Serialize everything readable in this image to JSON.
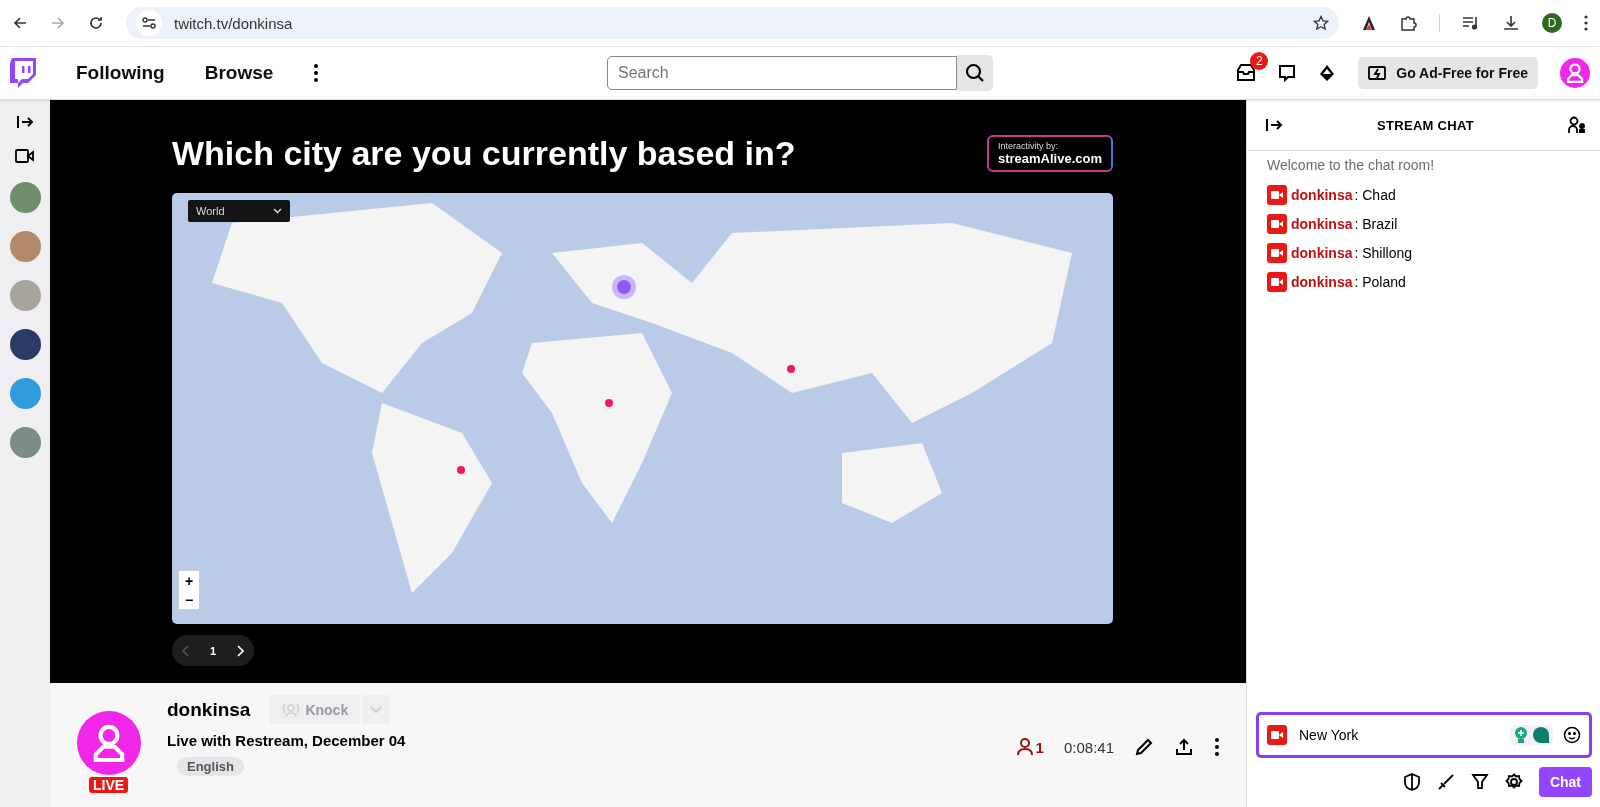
{
  "browser": {
    "url": "twitch.tv/donkinsa",
    "profile_initial": "D"
  },
  "nav": {
    "links": [
      "Following",
      "Browse"
    ],
    "search": {
      "placeholder": "Search"
    },
    "inbox_count": "2",
    "ad_free": "Go Ad-Free for Free"
  },
  "player": {
    "question": "Which city are you currently based in?",
    "badge_caption": "Interactivity by:",
    "badge_brand": "streamAlive.com",
    "map_region": "World",
    "zoom_in": "+",
    "zoom_out": "−",
    "page": "1"
  },
  "stream": {
    "channel": "donkinsa",
    "live_badge": "LIVE",
    "knock": "Knock",
    "title": "Live with Restream, December 04",
    "tag": "English",
    "viewers": "1",
    "uptime": "0:08:41"
  },
  "chat": {
    "title": "STREAM CHAT",
    "welcome": "Welcome to the chat room!",
    "messages": [
      {
        "user": "donkinsa",
        "text": ": Chad"
      },
      {
        "user": "donkinsa",
        "text": ": Brazil"
      },
      {
        "user": "donkinsa",
        "text": ": Shillong"
      },
      {
        "user": "donkinsa",
        "text": ": Poland"
      }
    ],
    "input": {
      "value": "New York"
    },
    "send": "Chat"
  }
}
